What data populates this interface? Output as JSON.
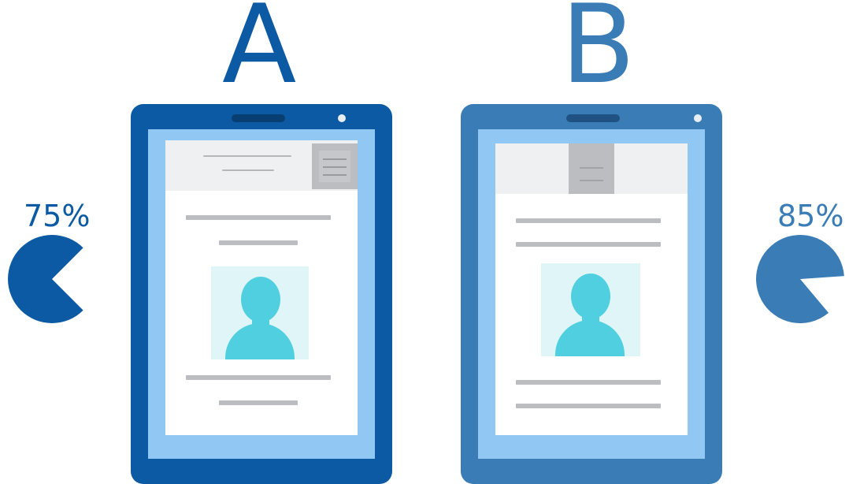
{
  "variant_a": {
    "letter": "A",
    "percentage_label": "75%",
    "percentage_value": 75,
    "color": "#0b5aa3"
  },
  "variant_b": {
    "letter": "B",
    "percentage_label": "85%",
    "percentage_value": 85,
    "color": "#3a7cb5"
  },
  "palette": {
    "screen": "#90c7f3",
    "header": "#eff0f1",
    "text_line": "#bcbdc1",
    "avatar": "#4fcfdf",
    "avatar_bg": "#dff5f8"
  },
  "icons": [
    "hamburger-menu-icon",
    "user-avatar-icon",
    "camera-icon",
    "speaker-icon"
  ]
}
